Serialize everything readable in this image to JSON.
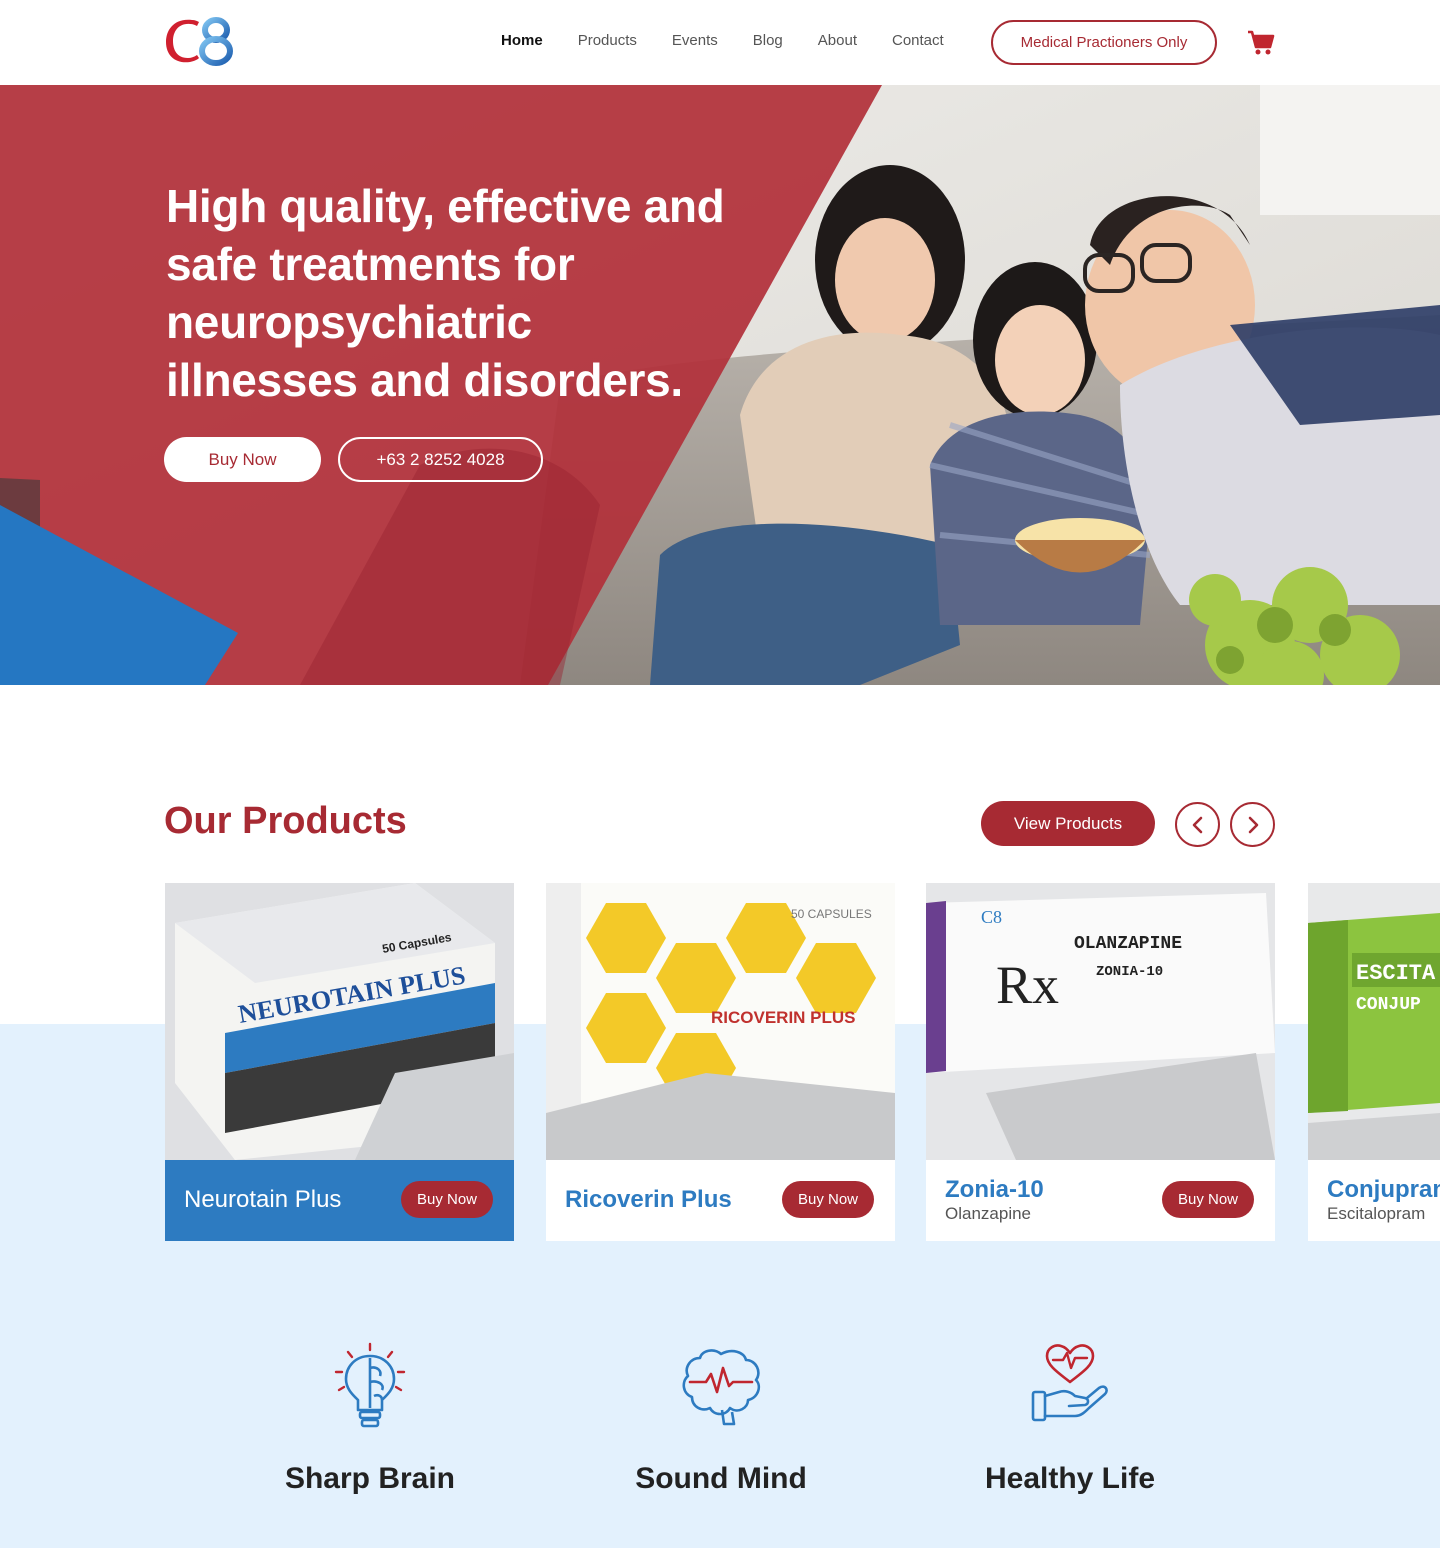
{
  "brand": {
    "logo_text": "C8"
  },
  "nav": {
    "items": [
      {
        "label": "Home",
        "active": true
      },
      {
        "label": "Products",
        "active": false
      },
      {
        "label": "Events",
        "active": false
      },
      {
        "label": "Blog",
        "active": false
      },
      {
        "label": "About",
        "active": false
      },
      {
        "label": "Contact",
        "active": false
      }
    ],
    "cta_label": "Medical Practioners Only",
    "cart_icon": "cart-icon"
  },
  "hero": {
    "title": "High quality, effective and safe treatments for neuropsychiatric illnesses and disorders.",
    "buy_label": "Buy Now",
    "phone_label": "+63 2 8252 4028"
  },
  "products": {
    "title": "Our Products",
    "view_label": "View Products",
    "prev_icon": "chevron-left-icon",
    "next_icon": "chevron-right-icon",
    "items": [
      {
        "name": "Neurotain Plus",
        "generic": "",
        "buy_label": "Buy Now",
        "box_text": "NEUROTAIN PLUS",
        "box_caption": "50 Capsules"
      },
      {
        "name": "Ricoverin Plus",
        "generic": "",
        "buy_label": "Buy Now",
        "box_text": "RICOVERIN PLUS",
        "box_caption": "50 CAPSULES"
      },
      {
        "name": "Zonia-10",
        "generic": "Olanzapine",
        "buy_label": "Buy Now",
        "box_text": "OLANZAPINE",
        "box_caption": "ZONIA-10"
      },
      {
        "name": "Conjupram",
        "generic": "Escitalopram",
        "buy_label": "Buy Now",
        "box_text": "ESCITA",
        "box_caption": "CONJUP"
      }
    ]
  },
  "features": [
    {
      "label": "Sharp Brain",
      "icon": "lightbulb-brain-icon"
    },
    {
      "label": "Sound Mind",
      "icon": "brain-pulse-icon"
    },
    {
      "label": "Healthy Life",
      "icon": "heart-hand-icon"
    }
  ],
  "colors": {
    "brand_red": "#a72a33",
    "brand_blue": "#2d7bc1",
    "light_blue": "#e3f1fd"
  }
}
